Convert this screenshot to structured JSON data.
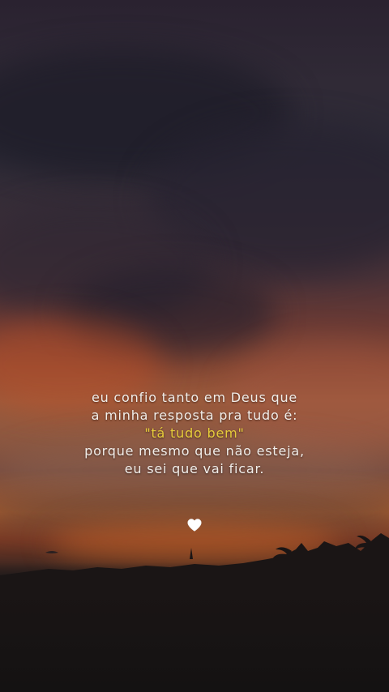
{
  "quote": {
    "line1": "eu confio tanto em Deus que",
    "line2": "a minha resposta pra tudo é:",
    "line3": "\"tá  tudo bem\"",
    "line4": "porque mesmo que não esteja,",
    "line5": "eu sei que vai ficar."
  },
  "colors": {
    "text": "#f2eeea",
    "highlight": "#e6cc3a",
    "heart": "#ffffff"
  },
  "icons": {
    "heart": "white-heart-icon"
  }
}
